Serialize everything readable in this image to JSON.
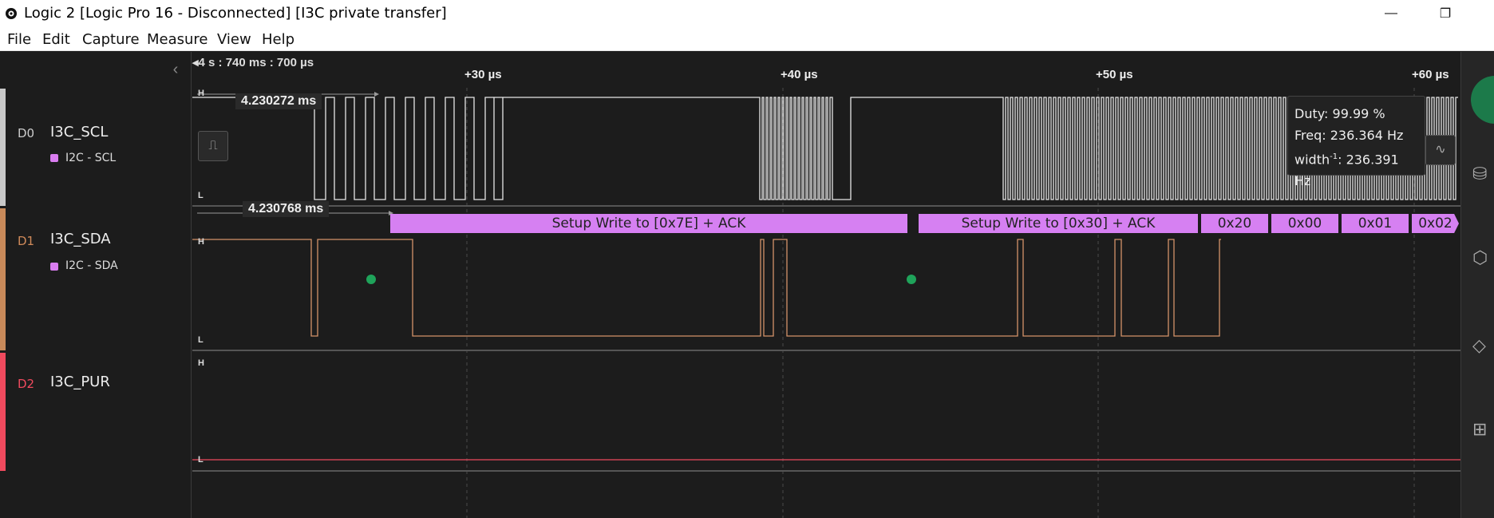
{
  "window": {
    "title": "Logic 2 [Logic Pro 16 - Disconnected] [I3C private transfer]",
    "minimize_glyph": "—",
    "restore_glyph": "❐"
  },
  "menu": {
    "items": [
      "File",
      "Edit",
      "Capture",
      "Measure",
      "View",
      "Help"
    ]
  },
  "ruler": {
    "origin": "4 s : 740 ms : 700 µs",
    "ticks": [
      "+30 µs",
      "+40 µs",
      "+50 µs",
      "+60 µs"
    ]
  },
  "channels": [
    {
      "id": "D0",
      "name": "I3C_SCL",
      "analyzer": "I2C - SCL",
      "color": "#c8c8c8"
    },
    {
      "id": "D1",
      "name": "I3C_SDA",
      "analyzer": "I2C - SDA",
      "color": "#c88a5a"
    },
    {
      "id": "D2",
      "name": "I3C_PUR",
      "analyzer": "",
      "color": "#f04a5e"
    }
  ],
  "levels": {
    "high": "H",
    "low": "L"
  },
  "measurements": {
    "scl_width": "4.230272 ms",
    "sda_width": "4.230768 ms"
  },
  "decoder": {
    "frames": [
      "Setup Write to [0x7E] + ACK",
      "Setup Write to [0x30] + ACK",
      "0x20",
      "0x00",
      "0x01",
      "0x02"
    ]
  },
  "tooltip": {
    "duty": "Duty: 99.99 %",
    "freq": "Freq: 236.364 Hz",
    "width_prefix": "width",
    "width_sup": "-1",
    "width_value": ": 236.391 Hz"
  },
  "colors": {
    "scl": "#e6e6e6",
    "sda": "#d4936a",
    "pur": "#f04a5e",
    "decoder": "#d680f2",
    "start_marker": "#1fa35a"
  }
}
